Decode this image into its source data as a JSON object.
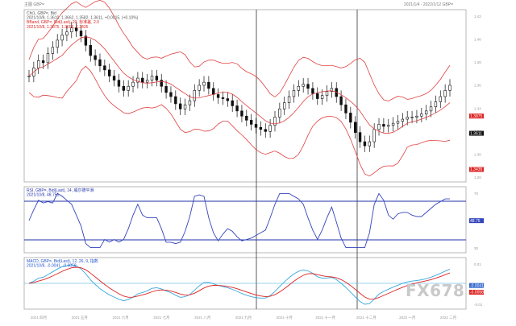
{
  "header": {
    "left": "主图 GBP=",
    "right": "2021/1/4 - 2022/1/12 GBP="
  },
  "panels": [
    {
      "id": "price",
      "legend": [
        {
          "text": "Cht1, GBP=, Bid",
          "color": "#555555"
        },
        {
          "text": "2021/10/8, 1.3610, 1.3662, 1.3582, 1.3611, +0.0015, (+0.10%)",
          "color": "#555555"
        },
        {
          "text": "BBand, GBP=, Bid(Last), 20, 标准差, 2.0",
          "color": "#dd2222"
        },
        {
          "text": "2021/10/8, 1.3875, 1.3655, 1.3435",
          "color": "#dd2222"
        }
      ],
      "ticks": [
        "1.42",
        "1.40",
        "1.38",
        "1.36",
        "1.34",
        "1.32",
        "1.30",
        "1.28"
      ],
      "tags": [
        {
          "text": "1.3875",
          "bg": "#dd2222"
        },
        {
          "text": "1.3611",
          "bg": "#111111"
        },
        {
          "text": "1.3435",
          "bg": "#dd2222"
        }
      ]
    },
    {
      "id": "rsi",
      "legend": [
        {
          "text": "RSI, GBP=, Bid(Last), 14, 威尔德平滑",
          "color": "#2233aa"
        },
        {
          "text": "2021/10/8, 48.751",
          "color": "#2233aa"
        }
      ],
      "ticks": [
        "70",
        "50",
        "30"
      ],
      "tags": [
        {
          "text": "48.75",
          "bg": "#3344bb"
        }
      ]
    },
    {
      "id": "macd",
      "legend": [
        {
          "text": "MACD, GBP=, Bid(Last), 12, 26, 9, 指数",
          "color": "#2255cc"
        },
        {
          "text": "2021/10/8, -0.0041, -0.0058",
          "color": "#2255cc"
        }
      ],
      "ticks": [
        "0.01",
        "0.00",
        "-0.01"
      ],
      "tags": [
        {
          "text": "-0.0041",
          "bg": "#3366cc"
        },
        {
          "text": "-0.0058",
          "bg": "#dd2222"
        }
      ]
    }
  ],
  "x_axis": {
    "months": [
      "2021 四月",
      "2021 五月",
      "2021 六月",
      "2021 七月",
      "2021 八月",
      "2021 九月",
      "2021 十月",
      "2021 十一月",
      "2021 十二月",
      "2022 一月",
      "2022 二月"
    ]
  },
  "watermark": "FX678",
  "colors": {
    "candle": "#111111",
    "band": "#e04040",
    "rsi": "#3344bb",
    "macd": "#38a8e0",
    "signal": "#dd2222",
    "guide": "#2233aa"
  },
  "chart_data": {
    "type": "line",
    "title": "GBP=",
    "x": [
      1,
      2,
      3,
      4,
      5,
      6,
      7,
      8,
      9,
      10,
      11,
      12,
      13,
      14,
      15,
      16,
      17,
      18,
      19,
      20,
      21,
      22,
      23,
      24,
      25,
      26,
      27,
      28,
      29,
      30,
      31,
      32,
      33,
      34,
      35,
      36,
      37,
      38,
      39,
      40,
      41,
      42,
      43,
      44,
      45,
      46,
      47,
      48,
      49,
      50,
      51,
      52,
      53,
      54,
      55,
      56,
      57,
      58,
      59,
      60,
      61,
      62,
      63,
      64,
      65,
      66,
      67,
      68,
      69,
      70,
      71,
      72,
      73,
      74,
      75,
      76,
      77,
      78,
      79,
      80,
      81,
      82,
      83,
      84,
      85,
      86,
      87,
      88,
      89,
      90
    ],
    "ylim": [
      1.27,
      1.43
    ],
    "series": [
      {
        "name": "GBP=",
        "values": [
          1.37,
          1.378,
          1.385,
          1.383,
          1.392,
          1.398,
          1.405,
          1.41,
          1.413,
          1.417,
          1.414,
          1.409,
          1.4,
          1.39,
          1.386,
          1.38,
          1.376,
          1.37,
          1.366,
          1.36,
          1.356,
          1.36,
          1.364,
          1.368,
          1.364,
          1.366,
          1.37,
          1.366,
          1.36,
          1.354,
          1.35,
          1.343,
          1.338,
          1.342,
          1.346,
          1.356,
          1.361,
          1.364,
          1.358,
          1.352,
          1.349,
          1.348,
          1.346,
          1.341,
          1.336,
          1.331,
          1.327,
          1.323,
          1.32,
          1.318,
          1.316,
          1.322,
          1.33,
          1.338,
          1.344,
          1.35,
          1.356,
          1.36,
          1.362,
          1.358,
          1.353,
          1.348,
          1.351,
          1.355,
          1.358,
          1.35,
          1.342,
          1.334,
          1.325,
          1.315,
          1.306,
          1.302,
          1.306,
          1.318,
          1.323,
          1.321,
          1.322,
          1.324,
          1.326,
          1.328,
          1.33,
          1.33,
          1.331,
          1.333,
          1.336,
          1.34,
          1.345,
          1.35,
          1.356,
          1.361
        ]
      }
    ]
  }
}
